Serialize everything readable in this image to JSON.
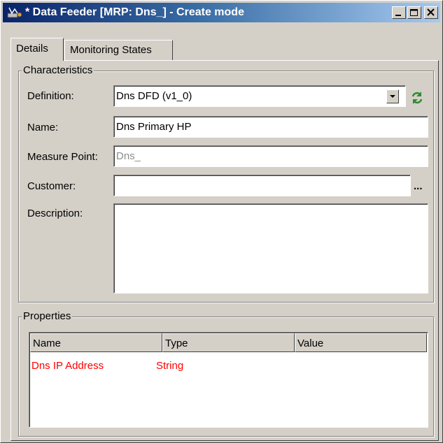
{
  "window": {
    "title": "* Data Feeder [MRP: Dns_] - Create mode",
    "controls": {
      "minimize": "_",
      "maximize": "□",
      "close": "X"
    }
  },
  "tabs": [
    {
      "label": "Details",
      "active": true
    },
    {
      "label": "Monitoring States",
      "active": false
    }
  ],
  "characteristics": {
    "legend": "Characteristics",
    "definition": {
      "label": "Definition:",
      "value": "Dns DFD (v1_0)"
    },
    "name": {
      "label": "Name:",
      "value": "Dns Primary HP"
    },
    "measure_point": {
      "label": "Measure Point:",
      "value": "Dns_"
    },
    "customer": {
      "label": "Customer:",
      "value": "",
      "browse": "..."
    },
    "description": {
      "label": "Description:",
      "value": ""
    }
  },
  "properties": {
    "legend": "Properties",
    "columns": [
      "Name",
      "Type",
      "Value"
    ],
    "rows": [
      {
        "name": "Dns IP Address",
        "type": "String",
        "value": ""
      }
    ],
    "row_color": "#ff0000"
  },
  "icons": {
    "app": "data-feeder-icon",
    "refresh": "refresh-icon",
    "dropdown": "chevron-down-icon"
  },
  "colors": {
    "title_bar_start": "#0a246a",
    "title_bar_end": "#a6caf0",
    "window_face": "#d4d0c8",
    "refresh_icon": "#2e8b2e"
  }
}
